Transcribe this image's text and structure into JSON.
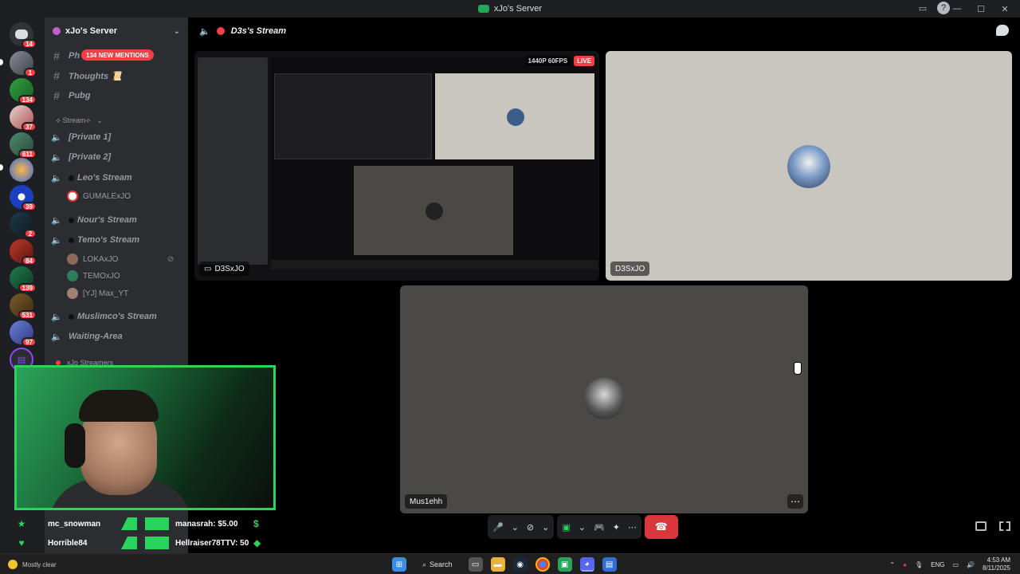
{
  "window": {
    "title": "xJo's Server"
  },
  "rail": {
    "badges": [
      "14",
      "1",
      "134",
      "37",
      "611",
      "",
      "39",
      "2",
      "84",
      "139",
      "531",
      "97",
      ""
    ]
  },
  "sidebar": {
    "server_name": "xJo's Server",
    "mentions_badge": "134 NEW MENTIONS",
    "text_channels": [
      {
        "name": "Ph"
      },
      {
        "name": "Thoughts 📜"
      },
      {
        "name": "Pubg"
      }
    ],
    "category": "⟡ Stream⟡",
    "voice_channels": [
      {
        "name": "[Private 1]"
      },
      {
        "name": "[Private 2]"
      },
      {
        "name": "Leo's Stream"
      },
      {
        "name": "Nour's Stream"
      },
      {
        "name": "Temo's Stream"
      },
      {
        "name": "Muslimco's Stream"
      },
      {
        "name": "Waiting-Area"
      }
    ],
    "users": {
      "leo": [
        "GUMALExJO"
      ],
      "temo": [
        "LOKAxJO",
        "TEMOxJO",
        "[YJ] Max_YT"
      ]
    },
    "bottom_category": "xJo Streamers"
  },
  "stage": {
    "channel": "D3s's Stream",
    "tiles": [
      {
        "name": "D3SxJO",
        "quality": "1440P 60FPS",
        "live": "LIVE"
      },
      {
        "name": "D3SxJO"
      },
      {
        "name": "Mus1ehh"
      }
    ]
  },
  "alerts": [
    {
      "user": "mc_snowman",
      "amount": "manasrah: $5.00",
      "end_icon": "$"
    },
    {
      "user": "Horrible84",
      "amount": "Hellraiser78TTV: 50",
      "end_icon": "◆"
    }
  ],
  "taskbar": {
    "weather": "Mostly clear",
    "search": "Search",
    "lang": "ENG",
    "time": "4:53 AM",
    "date": "8/11/2025"
  }
}
